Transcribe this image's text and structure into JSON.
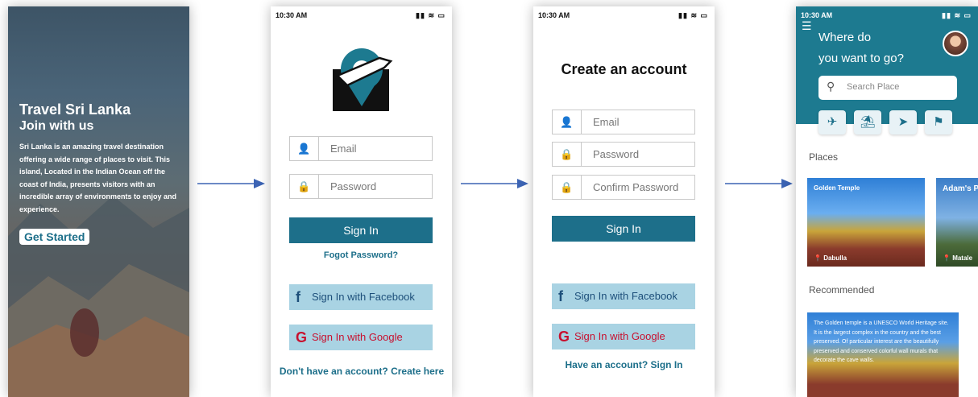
{
  "splash": {
    "title": "Travel  Sri Lanka",
    "subtitle": "Join with us",
    "description": "Sri Lanka is an amazing travel destination offering a wide range of places to visit. This island, Located in the Indian Ocean off the coast of India, presents visitors with an incredible array of environments to enjoy and experience.",
    "cta": "Get Started"
  },
  "signin": {
    "time": "10:30 AM",
    "status_icons": "▮▮ ≋ ▭",
    "email_placeholder": "Email",
    "password_placeholder": "Password",
    "sign_in": "Sign In",
    "forgot": "Fogot Password?",
    "facebook": "Sign In with Facebook",
    "google": "Sign In with Google",
    "create_link": "Don't have an account? Create here"
  },
  "register": {
    "time": "10:30 AM",
    "status_icons": "▮▮ ≋ ▭",
    "title": "Create an account",
    "email_placeholder": "Email",
    "password_placeholder": "Password",
    "confirm_placeholder": "Confirm Password",
    "sign_in": "Sign In",
    "facebook": "Sign In with Facebook",
    "google": "Sign In with Google",
    "have_account": "Have an account? Sign In"
  },
  "home": {
    "time": "10:30 AM",
    "status_icons": "▮▮ ≋ ▭",
    "question_line1": "Where do",
    "question_line2": "you want to go?",
    "search_placeholder": "Search Place",
    "places_label": "Places",
    "recommended_label": "Recommended",
    "places": [
      {
        "name": "Golden Temple",
        "location": "Dabulla"
      },
      {
        "name": "Adam's P",
        "location": "Matale"
      }
    ],
    "recommended_text": "The Golden temple is a UNESCO World Heritage site. It is the largest complex in the country and the best preserved. Of particular interest are the beautifully preserved and conserved colorful wall murals that decorate the cave walls."
  },
  "colors": {
    "primary": "#1d6f8a",
    "social_bg": "#a9d3e3",
    "facebook_text": "#1d4f7a",
    "google_text": "#c8102e"
  }
}
